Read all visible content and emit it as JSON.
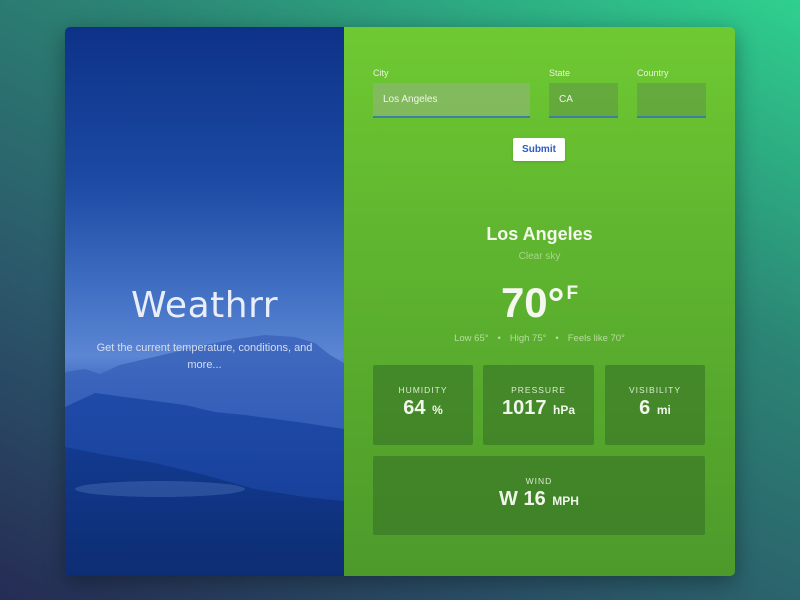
{
  "app": {
    "title": "Weathrr",
    "tagline": "Get the current temperature, conditions, and more..."
  },
  "form": {
    "city_label": "City",
    "city_value": "Los Angeles",
    "state_label": "State",
    "state_value": "CA",
    "country_label": "Country",
    "country_value": "",
    "submit_label": "Submit"
  },
  "weather": {
    "location": "Los Angeles",
    "conditions": "Clear sky",
    "temperature": "70°",
    "unit": "F",
    "low": "Low 65°",
    "high": "High 75°",
    "feels_like": "Feels like 70°",
    "separator": "•"
  },
  "stats": {
    "humidity": {
      "label": "HUMIDITY",
      "value": "64",
      "unit": "%"
    },
    "pressure": {
      "label": "PRESSURE",
      "value": "1017",
      "unit": "hPa"
    },
    "visibility": {
      "label": "VISIBILITY",
      "value": "6",
      "unit": "mi"
    },
    "wind": {
      "label": "WIND",
      "value": "W 16",
      "unit": "MPH"
    }
  },
  "colors": {
    "accent_green": "#5fb52f",
    "hero_blue": "#1c4aa4",
    "submit_text": "#2f5cc4"
  }
}
